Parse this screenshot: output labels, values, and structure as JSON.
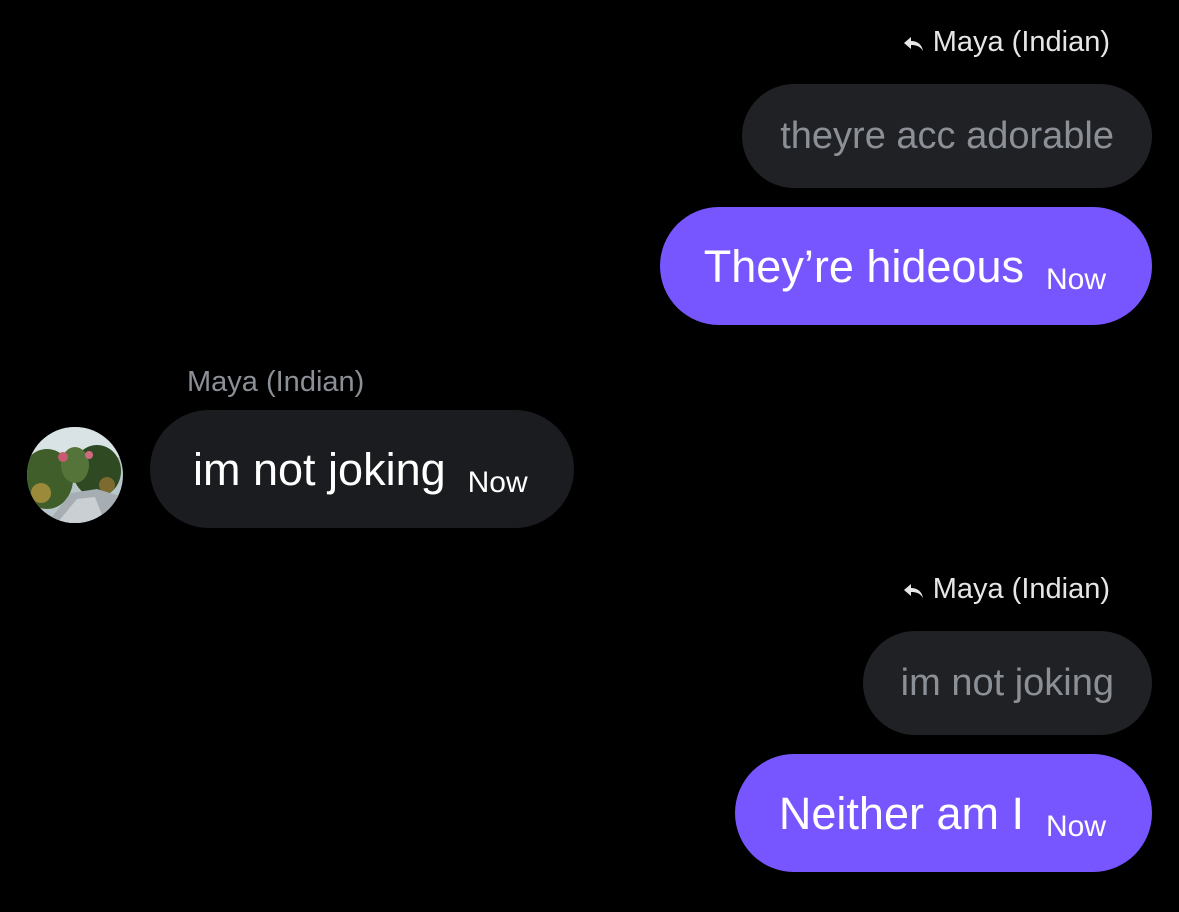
{
  "colors": {
    "background": "#000000",
    "outgoing_bubble": "#7856ff",
    "incoming_bubble": "#1b1c1f",
    "quoted_bubble": "#202124",
    "quoted_text": "#8b8f96",
    "secondary_text": "#8b8f96"
  },
  "messages": [
    {
      "reply_to_name": "Maya (Indian)",
      "reply_icon": "reply-arrow-icon",
      "quoted_text": "theyre acc adorable",
      "text": "They’re hideous",
      "time": "Now"
    },
    {
      "sender_name": "Maya (Indian)",
      "avatar_icon": "avatar-photo",
      "text": "im not joking",
      "time": "Now"
    },
    {
      "reply_to_name": "Maya (Indian)",
      "reply_icon": "reply-arrow-icon",
      "quoted_text": "im not joking",
      "text": "Neither am I",
      "time": "Now"
    }
  ]
}
